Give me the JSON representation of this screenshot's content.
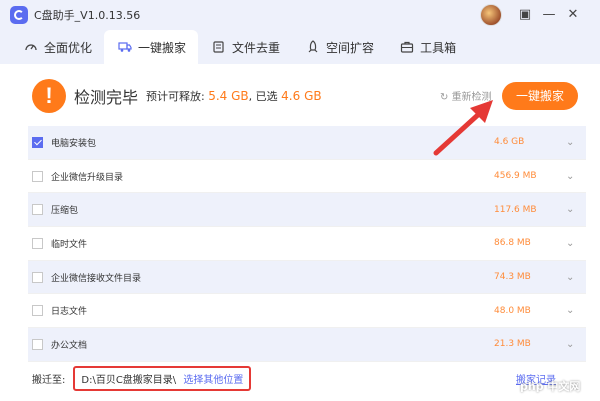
{
  "window": {
    "title": "C盘助手_V1.0.13.56",
    "minimize_glyph": "—",
    "close_glyph": "✕",
    "skin_glyph": "▣"
  },
  "tabs": [
    {
      "label": "全面优化",
      "icon": "gauge-icon",
      "active": false
    },
    {
      "label": "一键搬家",
      "icon": "truck-icon",
      "active": true
    },
    {
      "label": "文件去重",
      "icon": "files-icon",
      "active": false
    },
    {
      "label": "空间扩容",
      "icon": "rocket-icon",
      "active": false
    },
    {
      "label": "工具箱",
      "icon": "toolbox-icon",
      "active": false
    }
  ],
  "summary": {
    "icon_glyph": "!",
    "title": "检测完毕",
    "movable_label": "预计可释放:",
    "movable_value": "5.4 GB",
    "selected_label": ", 已选",
    "selected_value": "4.6 GB",
    "rescan_label": "重新检测",
    "move_button": "一键搬家"
  },
  "items": [
    {
      "name": "电脑安装包",
      "size": "4.6 GB",
      "checked": true
    },
    {
      "name": "企业微信升级目录",
      "size": "456.9 MB",
      "checked": false
    },
    {
      "name": "压缩包",
      "size": "117.6 MB",
      "checked": false
    },
    {
      "name": "临时文件",
      "size": "86.8 MB",
      "checked": false
    },
    {
      "name": "企业微信接收文件目录",
      "size": "74.3 MB",
      "checked": false
    },
    {
      "name": "日志文件",
      "size": "48.0 MB",
      "checked": false
    },
    {
      "name": "办公文档",
      "size": "21.3 MB",
      "checked": false
    }
  ],
  "footer": {
    "label": "搬迁至:",
    "path": "D:\\百贝C盘搬家目录\\",
    "choose_link": "选择其他位置",
    "history_link": "搬家记录"
  },
  "colors": {
    "accent": "#5b6cf0",
    "orange": "#ff7a1a",
    "highlight_box": "#e53935"
  },
  "watermark": "php 中文网"
}
